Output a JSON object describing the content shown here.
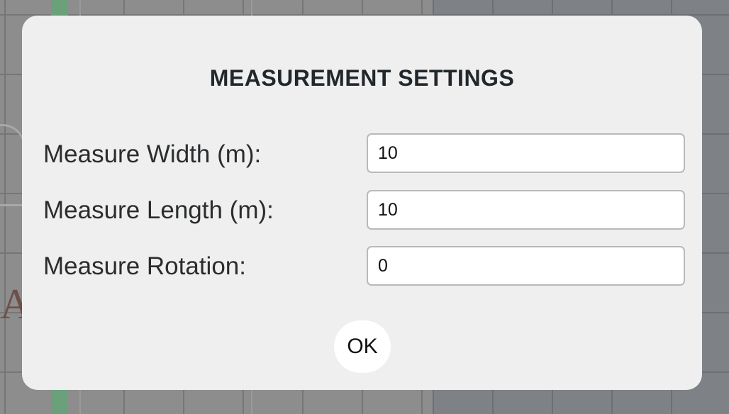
{
  "dialog": {
    "title": "MEASUREMENT SETTINGS",
    "fields": [
      {
        "label": "Measure Width (m):",
        "value": "10"
      },
      {
        "label": "Measure Length (m):",
        "value": "10"
      },
      {
        "label": "Measure Rotation:",
        "value": "0"
      }
    ],
    "ok_label": "OK"
  },
  "background": {
    "partial_letter": "A"
  },
  "colors": {
    "dialog_bg": "#efefef",
    "title": "#22272c",
    "backdrop": "#8d8d8d",
    "accent_green": "#6aa07a"
  }
}
